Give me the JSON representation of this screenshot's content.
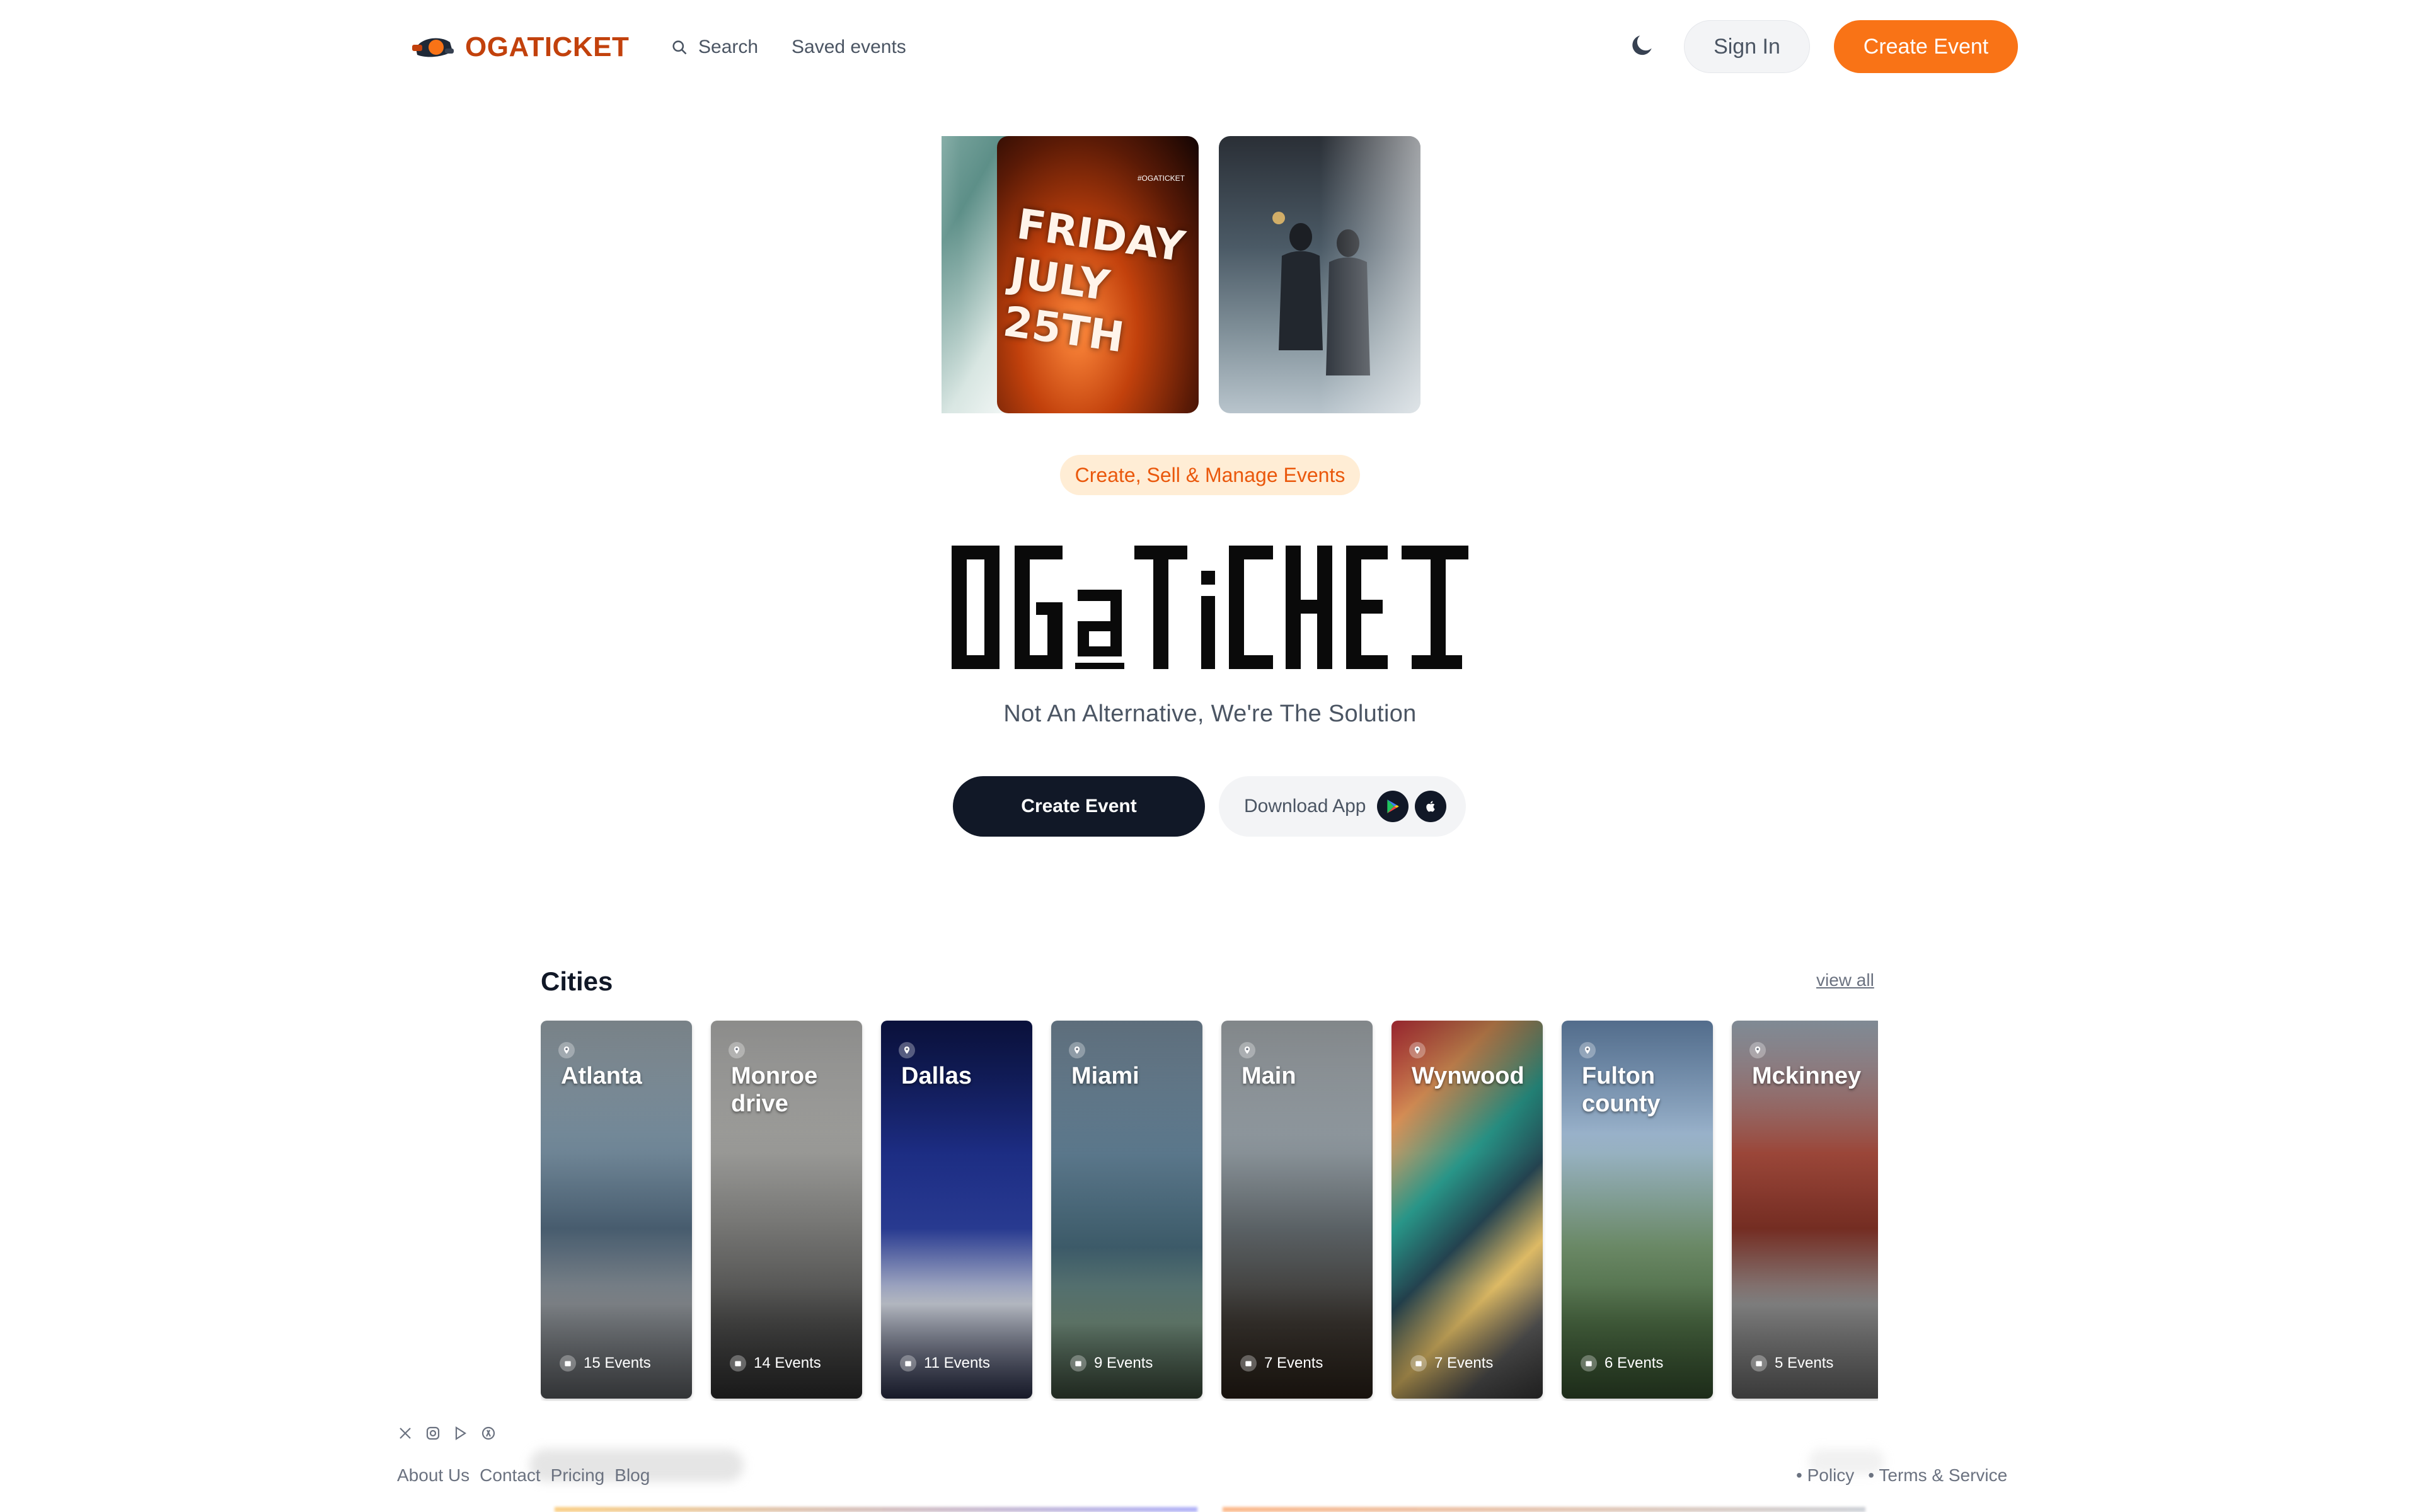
{
  "header": {
    "logo_text": "OGATICKET",
    "search_label": "Search",
    "saved_label": "Saved events",
    "sign_in_label": "Sign In",
    "create_event_label": "Create Event"
  },
  "hero": {
    "slides": [
      {
        "caption": ""
      },
      {
        "caption": "FRIDAY JULY 25TH",
        "handle": "#OGATICKET"
      },
      {
        "caption": ""
      }
    ],
    "tagline": "Create, Sell & Manage Events",
    "wordmark": "OGATICKET",
    "subtitle": "Not An Alternative, We're The Solution",
    "create_event_label": "Create Event",
    "download_label": "Download App"
  },
  "cities": {
    "title": "Cities",
    "view_all_label": "view all",
    "items": [
      {
        "name": "Atlanta",
        "count": "15 Events"
      },
      {
        "name": "Monroe drive",
        "count": "14 Events"
      },
      {
        "name": "Dallas",
        "count": "11 Events"
      },
      {
        "name": "Miami",
        "count": "9 Events"
      },
      {
        "name": "Main",
        "count": "7 Events"
      },
      {
        "name": "Wynwood",
        "count": "7 Events"
      },
      {
        "name": "Fulton county",
        "count": "6 Events"
      },
      {
        "name": "Mckinney",
        "count": "5 Events"
      }
    ]
  },
  "footer": {
    "social_icons": [
      "x-icon",
      "instagram-icon",
      "play-store-icon",
      "app-store-icon"
    ],
    "links": [
      "About Us",
      "Contact",
      "Pricing",
      "Blog"
    ],
    "legal": [
      "Policy",
      "Terms & Service"
    ]
  },
  "colors": {
    "accent": "#f97316",
    "dark": "#111827",
    "tagline_bg": "#ffedd5",
    "logo": "#c2410c"
  }
}
